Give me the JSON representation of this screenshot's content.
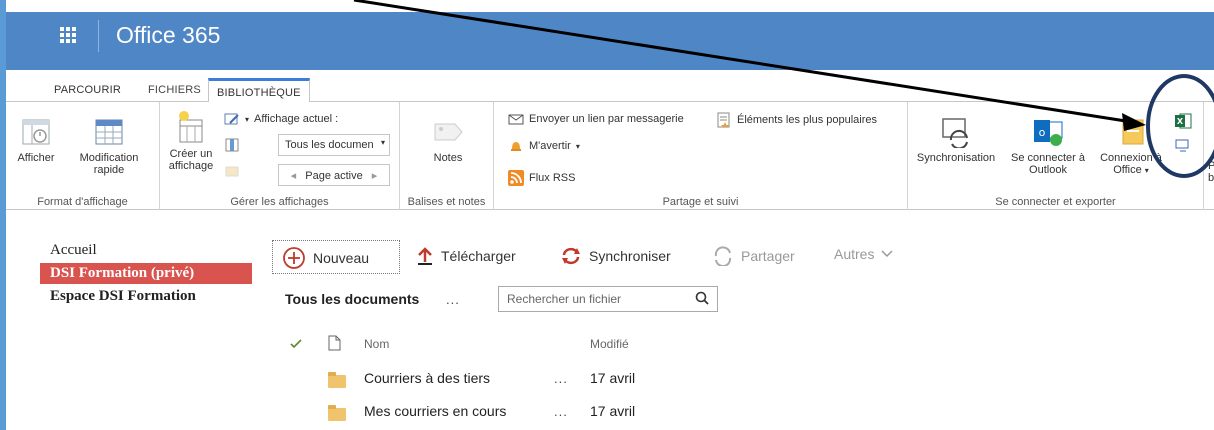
{
  "suite": {
    "title": "Office 365"
  },
  "tabs": [
    {
      "label": "PARCOURIR"
    },
    {
      "label": "FICHIERS"
    },
    {
      "label": "BIBLIOTHÈQUE"
    }
  ],
  "ribbon": {
    "format": {
      "label": "Format d'affichage",
      "afficher": "Afficher",
      "modification": [
        "Modification",
        "rapide"
      ]
    },
    "gerer": {
      "label": "Gérer les affichages",
      "creer": [
        "Créer un",
        "affichage"
      ],
      "affichage_actuel": "Affichage actuel :",
      "view_select": "Tous les documen",
      "page_active": "Page active"
    },
    "balises": {
      "label": "Balises et notes",
      "notes": "Notes"
    },
    "partage": {
      "label": "Partage et suivi",
      "envoyer": "Envoyer un lien par messagerie",
      "mavertir": "M'avertir",
      "flux": "Flux RSS",
      "populaires": "Éléments les plus populaires"
    },
    "connecter": {
      "label": "Se connecter et exporter",
      "sync": "Synchronisation",
      "outlook": [
        "Se connecter à",
        "Outlook"
      ],
      "office": [
        "Connexion à",
        "Office"
      ],
      "truncated": [
        "P",
        "b"
      ]
    }
  },
  "leftnav": {
    "items": [
      {
        "label": "Accueil"
      },
      {
        "label": "DSI Formation (privé)"
      },
      {
        "label": "Espace DSI Formation"
      }
    ]
  },
  "commands": {
    "nouveau": "Nouveau",
    "telecharger": "Télécharger",
    "synchroniser": "Synchroniser",
    "partager": "Partager",
    "autres": "Autres"
  },
  "view": {
    "title": "Tous les documents",
    "dots": "...",
    "search_placeholder": "Rechercher un fichier"
  },
  "list": {
    "col_name": "Nom",
    "col_modified": "Modifié",
    "rows": [
      {
        "name": "Courriers à des tiers",
        "dots": "...",
        "modified": "17 avril"
      },
      {
        "name": "Mes courriers en cours",
        "dots": "...",
        "modified": "17 avril"
      }
    ]
  },
  "colors": {
    "suite_bar": "#4e86c6",
    "accent_tab": "#3b7dd8",
    "nav_active": "#d9534f",
    "annotation": "#1f3864"
  }
}
